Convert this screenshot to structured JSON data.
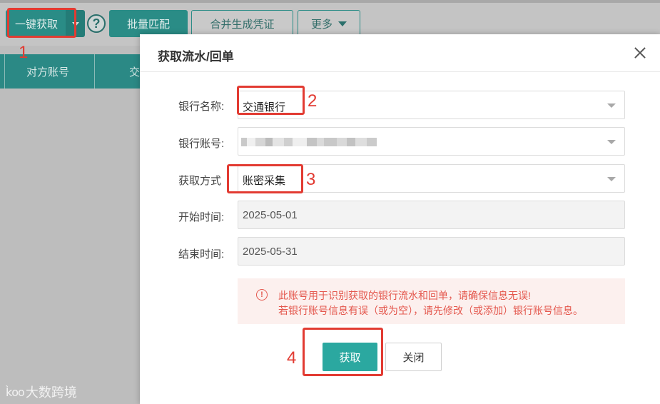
{
  "toolbar": {
    "one_click_fetch": "一键获取",
    "help": "?",
    "batch_match": "批量匹配",
    "merge_voucher": "合并生成凭证",
    "more": "更多"
  },
  "table": {
    "col_counterparty_account": "对方账号",
    "col_next": "交"
  },
  "dialog": {
    "title": "获取流水/回单",
    "fields": {
      "bank_name_label": "银行名称:",
      "bank_name_value": "交通银行",
      "bank_account_label": "银行账号:",
      "fetch_method_label": "获取方式",
      "fetch_method_value": "账密采集",
      "start_time_label": "开始时间:",
      "start_time_value": "2025-05-01",
      "end_time_label": "结束时间:",
      "end_time_value": "2025-05-31"
    },
    "alert": {
      "icon": "!",
      "line1": "此账号用于识别获取的银行流水和回单，请确保信息无误!",
      "line2": "若银行账号信息有误（或为空），请先修改（或添加）银行账号信息。"
    },
    "fetch_button": "获取",
    "close_button": "关闭"
  },
  "annotations": {
    "step1": "1",
    "step2": "2",
    "step3": "3",
    "step4": "4"
  },
  "watermark": {
    "logo": "k̀oo",
    "text": "大数跨境"
  },
  "colors": {
    "accent": "#2ba8a0",
    "annotation_red": "#e23b32",
    "alert_text": "#e4584e"
  }
}
